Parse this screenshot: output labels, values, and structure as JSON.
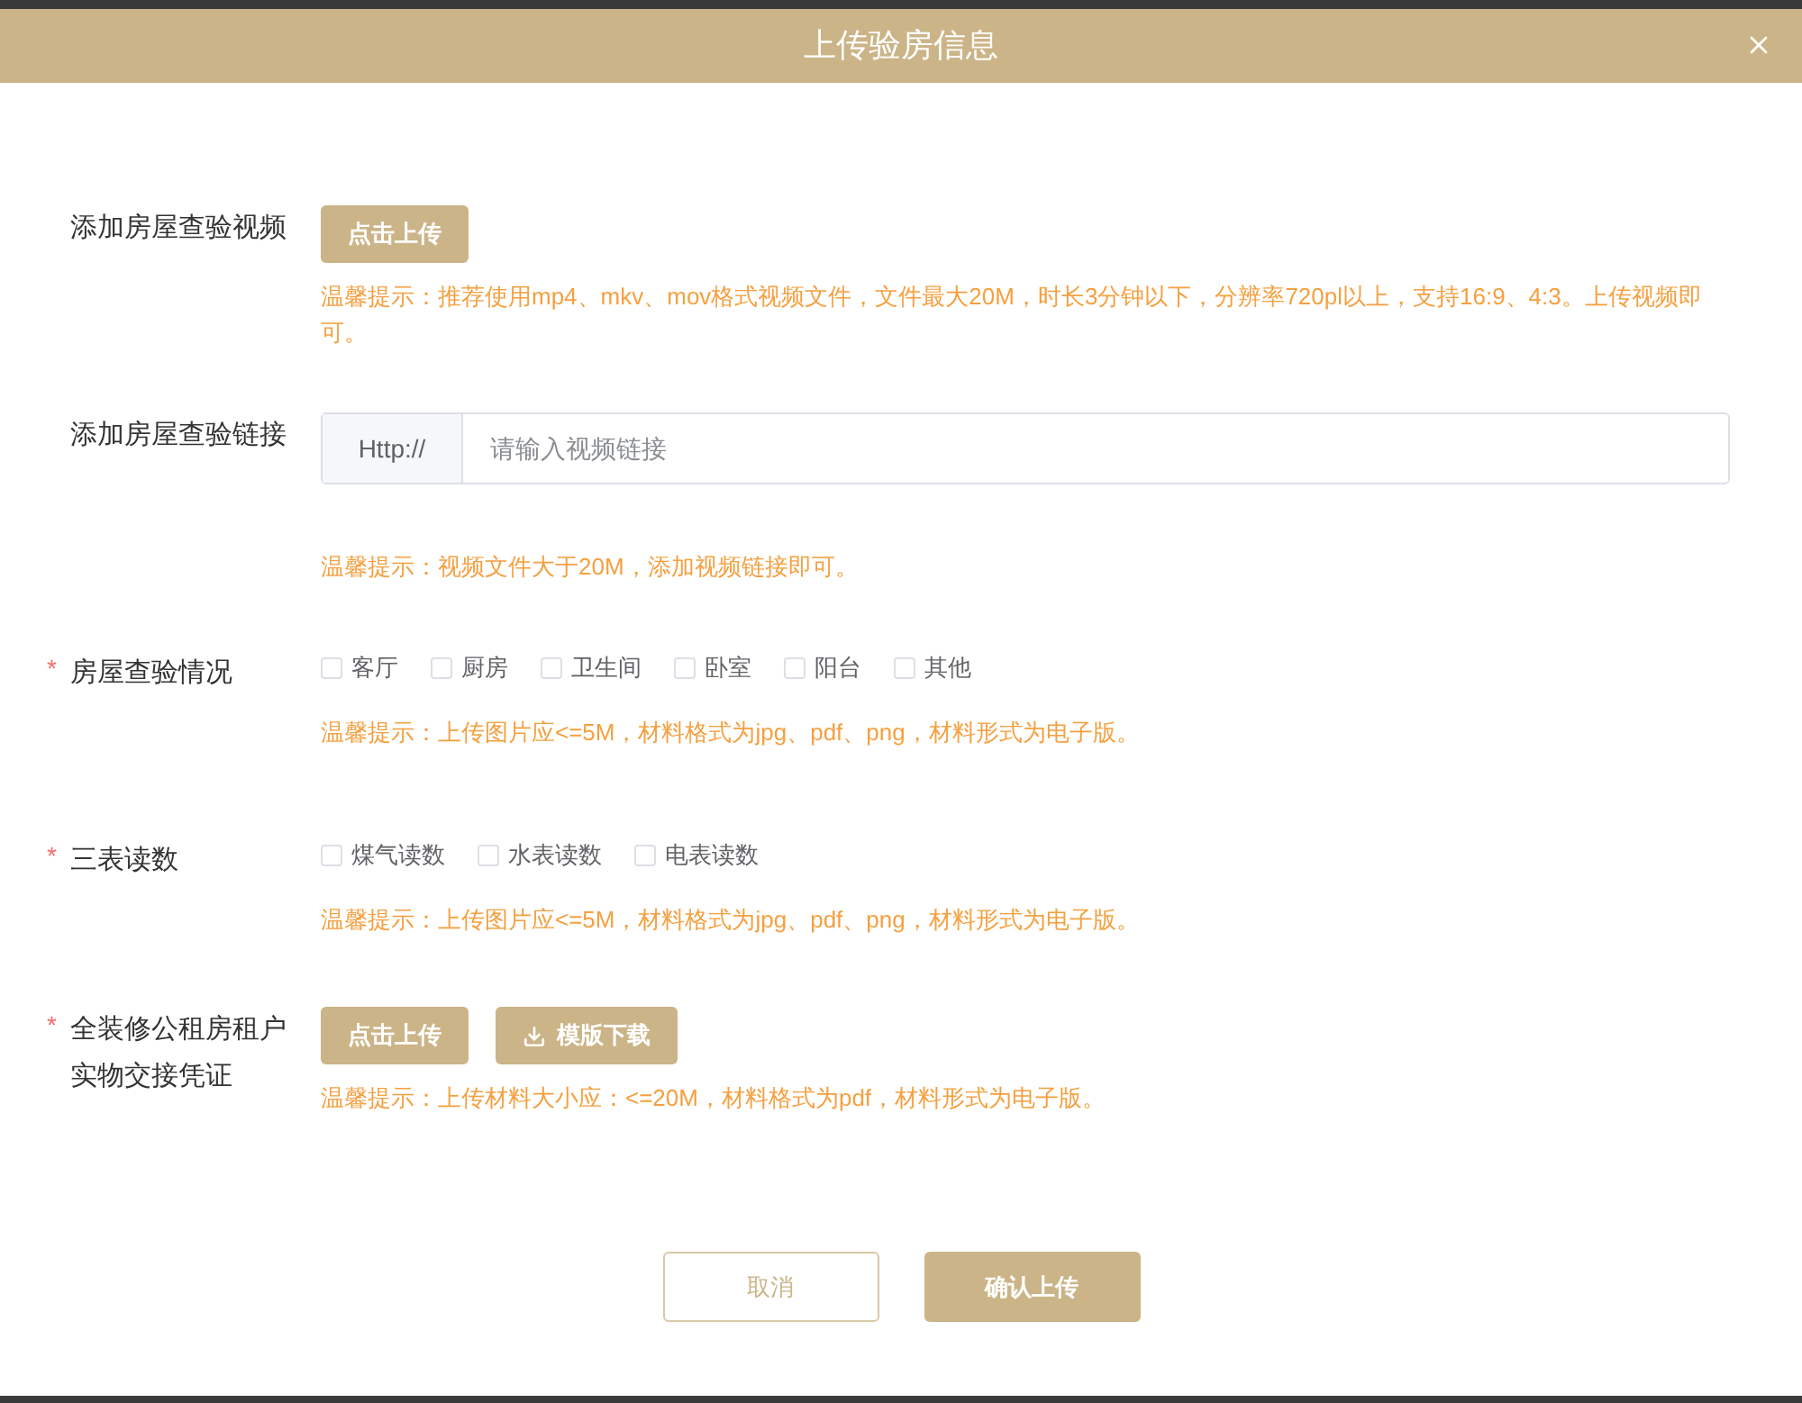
{
  "dialog": {
    "title": "上传验房信息"
  },
  "sections": [
    {
      "kind": "upload",
      "label": "添加房屋查验视频",
      "buttons": [
        {
          "label": "点击上传",
          "icon": false
        }
      ],
      "hint": "温馨提示：推荐使用mp4、mkv、mov格式视频文件，文件最大20M，时长3分钟以下，分辨率720pl以上，支持16:9、4:3。上传视频即可。"
    },
    {
      "kind": "link",
      "label": "添加房屋查验链接",
      "prefix": "Http://",
      "placeholder": "请输入视频链接",
      "hint": "温馨提示：视频文件大于20M，添加视频链接即可。"
    },
    {
      "kind": "checkboxes",
      "label": "房屋查验情况",
      "required_mark": "*",
      "options": [
        {
          "label": "客厅",
          "checked": false
        },
        {
          "label": "厨房",
          "checked": false
        },
        {
          "label": "卫生间",
          "checked": false
        },
        {
          "label": "卧室",
          "checked": false
        },
        {
          "label": "阳台",
          "checked": false
        },
        {
          "label": "其他",
          "checked": false
        }
      ],
      "hint": "温馨提示：上传图片应<=5M，材料格式为jpg、pdf、png，材料形式为电子版。"
    },
    {
      "kind": "checkboxes",
      "label": "三表读数",
      "required_mark": "*",
      "options": [
        {
          "label": "煤气读数",
          "checked": false
        },
        {
          "label": "水表读数",
          "checked": false
        },
        {
          "label": "电表读数",
          "checked": false
        }
      ],
      "hint": "温馨提示：上传图片应<=5M，材料格式为jpg、pdf、png，材料形式为电子版。"
    },
    {
      "kind": "upload",
      "label": "全装修公租房租户实物交接凭证",
      "required_mark": "*",
      "buttons": [
        {
          "label": "点击上传",
          "icon": false
        },
        {
          "label": "模版下载",
          "icon": true
        }
      ],
      "hint": "温馨提示：上传材料大小应：<=20M，材料格式为pdf，材料形式为电子版。"
    }
  ],
  "footer": {
    "cancel": "取消",
    "confirm": "确认上传"
  }
}
